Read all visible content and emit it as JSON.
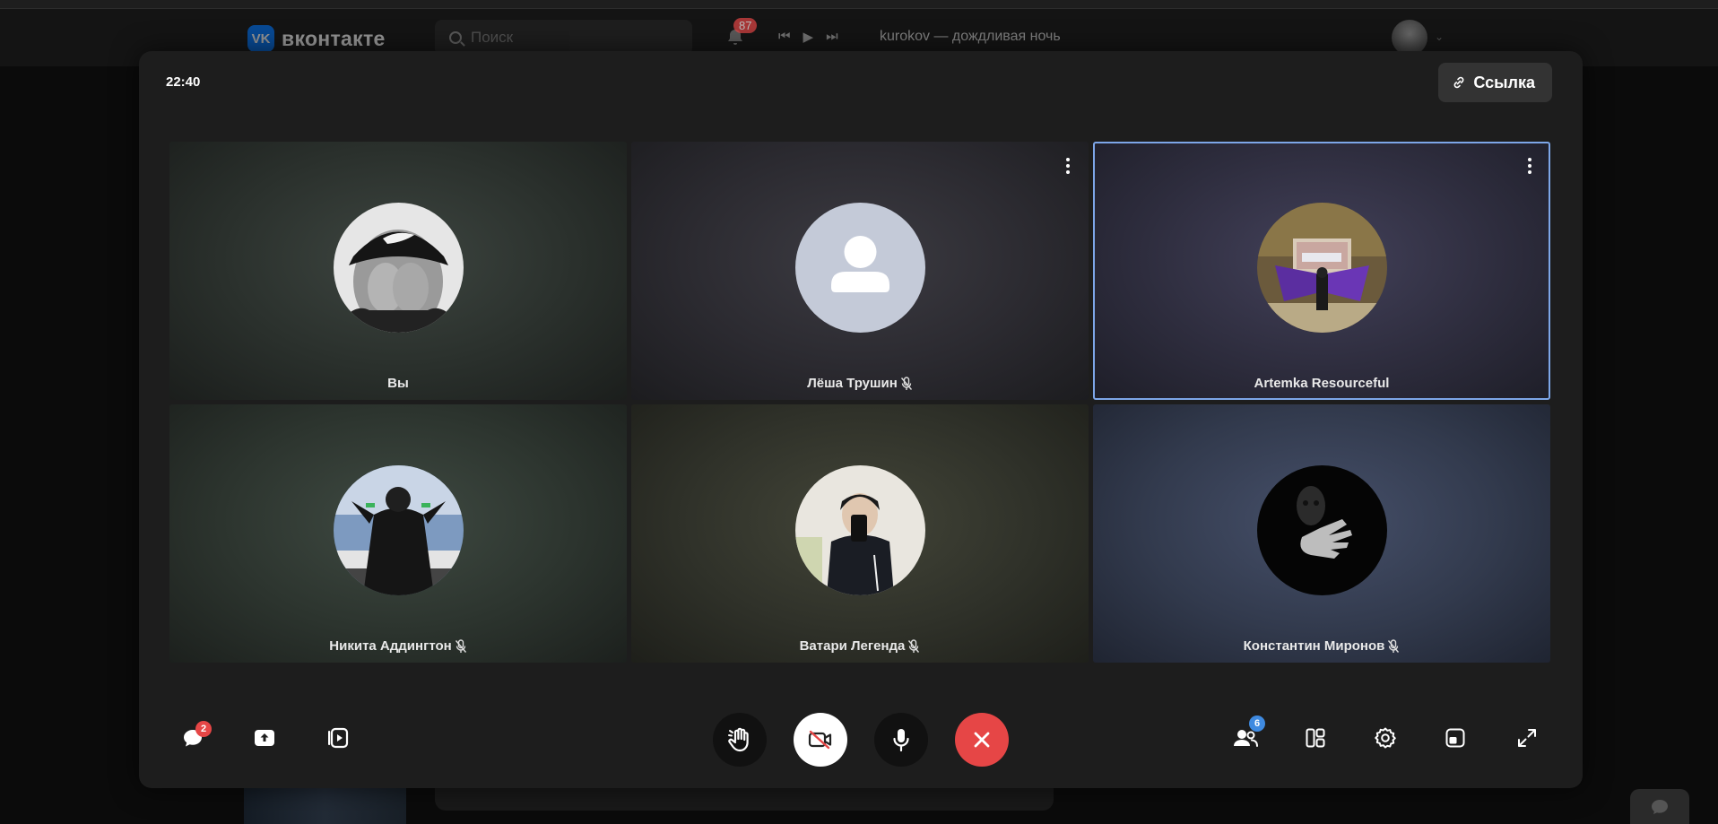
{
  "background": {
    "logo_text": "вконтакте",
    "logo_mark": "VK",
    "search_placeholder": "Поиск",
    "notifications_count": "87",
    "now_playing": "kurokov — дождливая ночь"
  },
  "call": {
    "time": "22:40",
    "link_label": "Ссылка",
    "participants": [
      {
        "name": "Вы",
        "mic_muted": false,
        "has_menu": false,
        "active": false,
        "avatar": "photo-nike-cap"
      },
      {
        "name": "Лёша Трушин",
        "mic_muted": true,
        "has_menu": true,
        "active": false,
        "avatar": "default-person-icon"
      },
      {
        "name": "Artemka Resourceful",
        "mic_muted": false,
        "has_menu": true,
        "active": true,
        "avatar": "photo-winged-figure"
      },
      {
        "name": "Никита Аддингтон",
        "mic_muted": true,
        "has_menu": false,
        "active": false,
        "avatar": "photo-dark-hoodie"
      },
      {
        "name": "Ватари Легенда",
        "mic_muted": true,
        "has_menu": false,
        "active": false,
        "avatar": "photo-mirror-selfie"
      },
      {
        "name": "Константин Миронов",
        "mic_muted": true,
        "has_menu": false,
        "active": false,
        "avatar": "photo-dark-hand"
      }
    ],
    "toolbar": {
      "chat_badge": "2",
      "participants_badge": "6"
    }
  },
  "colors": {
    "accent_blue": "#0077ff",
    "active_tile_border": "#7da6e8",
    "end_call_red": "#e64646",
    "badge_red": "#e64646",
    "badge_blue": "#3f8ae0"
  }
}
